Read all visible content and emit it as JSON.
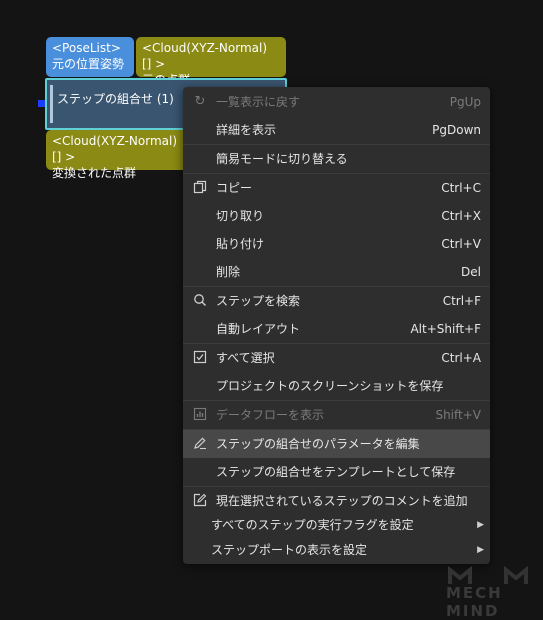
{
  "nodes": {
    "input_port_1": {
      "type": "<PoseList>",
      "desc": "元の位置姿勢"
    },
    "input_port_2": {
      "type": "<Cloud(XYZ-Normal) [] >",
      "desc": "元の点群"
    },
    "step": {
      "title": "ステップの組合せ (1)"
    },
    "output_port": {
      "type": "<Cloud(XYZ-Normal) [] >",
      "desc": "変換された点群"
    }
  },
  "menu": {
    "back": {
      "label": "一覧表示に戻す",
      "shortcut": "PgUp"
    },
    "details": {
      "label": "詳細を表示",
      "shortcut": "PgDown"
    },
    "simple_mode": {
      "label": "簡易モードに切り替える"
    },
    "copy": {
      "label": "コピー",
      "shortcut": "Ctrl+C"
    },
    "cut": {
      "label": "切り取り",
      "shortcut": "Ctrl+X"
    },
    "paste": {
      "label": "貼り付け",
      "shortcut": "Ctrl+V"
    },
    "delete": {
      "label": "削除",
      "shortcut": "Del"
    },
    "search": {
      "label": "ステップを検索",
      "shortcut": "Ctrl+F"
    },
    "auto_layout": {
      "label": "自動レイアウト",
      "shortcut": "Alt+Shift+F"
    },
    "select_all": {
      "label": "すべて選択",
      "shortcut": "Ctrl+A"
    },
    "screenshot": {
      "label": "プロジェクトのスクリーンショットを保存"
    },
    "dataflow": {
      "label": "データフローを表示",
      "shortcut": "Shift+V"
    },
    "edit_params": {
      "label": "ステップの組合せのパラメータを編集"
    },
    "save_template": {
      "label": "ステップの組合せをテンプレートとして保存"
    },
    "add_comment": {
      "label": "現在選択されているステップのコメントを追加"
    },
    "exec_flags": {
      "label": "すべてのステップの実行フラグを設定"
    },
    "port_display": {
      "label": "ステップポートの表示を設定"
    }
  },
  "logo": {
    "text": "MECH MIND"
  }
}
